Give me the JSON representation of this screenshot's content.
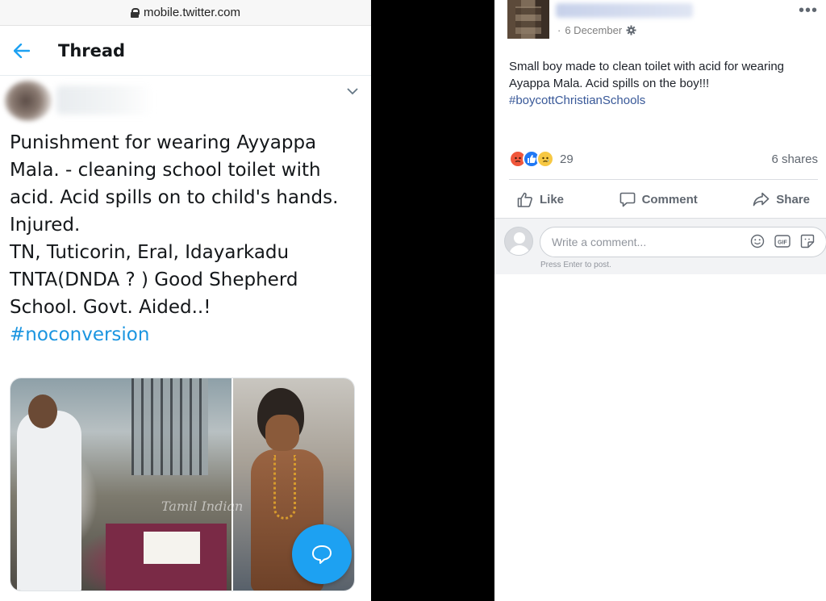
{
  "twitter": {
    "url": "mobile.twitter.com",
    "header_title": "Thread",
    "tweet_text": "Punishment for wearing Ayyappa\nMala. - cleaning school toilet with\nacid. Acid spills on to child's hands.\nInjured.\nTN, Tuticorin, Eral, Idayarkadu\nTNTA(DNDA ? ) Good Shepherd\nSchool. Govt. Aided..!",
    "hashtag": "#noconversion",
    "watermark": "Tamil Indian"
  },
  "facebook": {
    "date": "6 December",
    "post_text": "Small boy made to clean toilet with acid for wearing Ayappa Mala. Acid spills on the boy!!!",
    "hashtag": "#boycottChristianSchools",
    "reaction_count": "29",
    "shares": "6 shares",
    "actions": {
      "like": "Like",
      "comment": "Comment",
      "share": "Share"
    },
    "comment_placeholder": "Write a comment...",
    "press_enter_hint": "Press Enter to post.",
    "colors": {
      "link": "#385898",
      "angry": "#f0573b",
      "like": "#2078f4",
      "sad": "#f7c843"
    }
  }
}
